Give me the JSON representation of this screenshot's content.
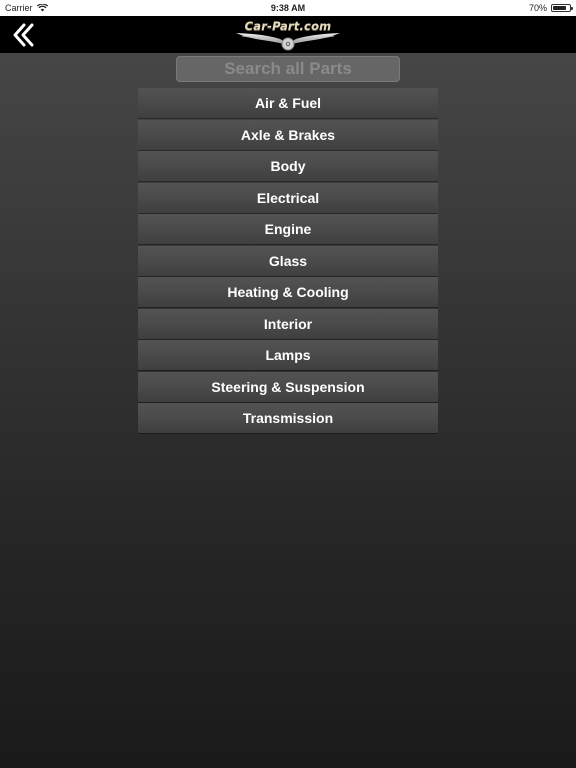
{
  "status_bar": {
    "carrier": "Carrier",
    "time": "9:38 AM",
    "battery": "70%"
  },
  "nav": {
    "logo_text": "Car-Part.com"
  },
  "search": {
    "placeholder": "Search all Parts"
  },
  "categories": [
    {
      "label": "Air & Fuel"
    },
    {
      "label": "Axle & Brakes"
    },
    {
      "label": "Body"
    },
    {
      "label": "Electrical"
    },
    {
      "label": "Engine"
    },
    {
      "label": "Glass"
    },
    {
      "label": "Heating & Cooling"
    },
    {
      "label": "Interior"
    },
    {
      "label": "Lamps"
    },
    {
      "label": "Steering & Suspension"
    },
    {
      "label": "Transmission"
    }
  ],
  "colors": {
    "nav_background": "#000000",
    "item_background": "#4a4a4a",
    "item_text": "#ffffff",
    "logo_text": "#e7dcc0"
  }
}
